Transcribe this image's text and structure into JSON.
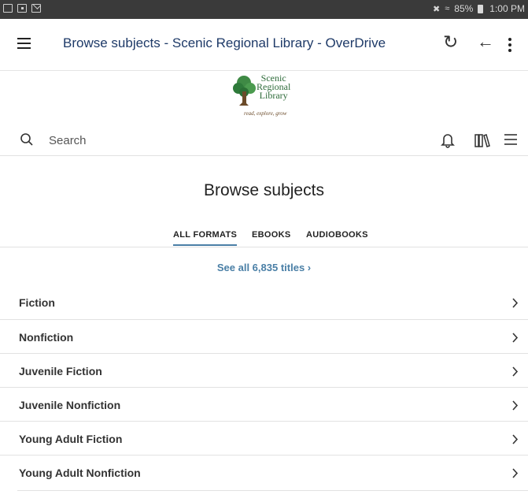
{
  "status_bar": {
    "battery": "85%",
    "time": "1:00 PM",
    "left_icons": [
      "gallery-icon",
      "flipboard-icon",
      "mail-icon"
    ],
    "right_icons": [
      "mute-icon",
      "wifi-icon",
      "battery-icon"
    ]
  },
  "app_bar": {
    "title": "Browse subjects - Scenic Regional Library - OverDrive",
    "icons": [
      "menu-icon",
      "reload-icon",
      "back-arrow-icon",
      "more-vert-icon"
    ]
  },
  "logo": {
    "line1": "Scenic",
    "line2": "Regional",
    "line3": "Library",
    "tagline": "read, explore, grow"
  },
  "search": {
    "placeholder": "Search"
  },
  "toolbar_icons": [
    "notifications-icon",
    "library-shelf-icon",
    "menu-icon"
  ],
  "page": {
    "heading": "Browse subjects",
    "see_all": "See all 6,835 titles ›"
  },
  "tabs": [
    {
      "label": "ALL FORMATS",
      "active": true
    },
    {
      "label": "EBOOKS",
      "active": false
    },
    {
      "label": "AUDIOBOOKS",
      "active": false
    }
  ],
  "subjects": [
    {
      "label": "Fiction"
    },
    {
      "label": "Nonfiction"
    },
    {
      "label": "Juvenile Fiction"
    },
    {
      "label": "Juvenile Nonfiction"
    },
    {
      "label": "Young Adult Fiction"
    },
    {
      "label": "Young Adult Nonfiction"
    }
  ],
  "colors": {
    "title_text": "#1e3a68",
    "accent": "#4a7fa6",
    "logo_green": "#2e6b3a",
    "status_bar": "#3a3a3a"
  }
}
